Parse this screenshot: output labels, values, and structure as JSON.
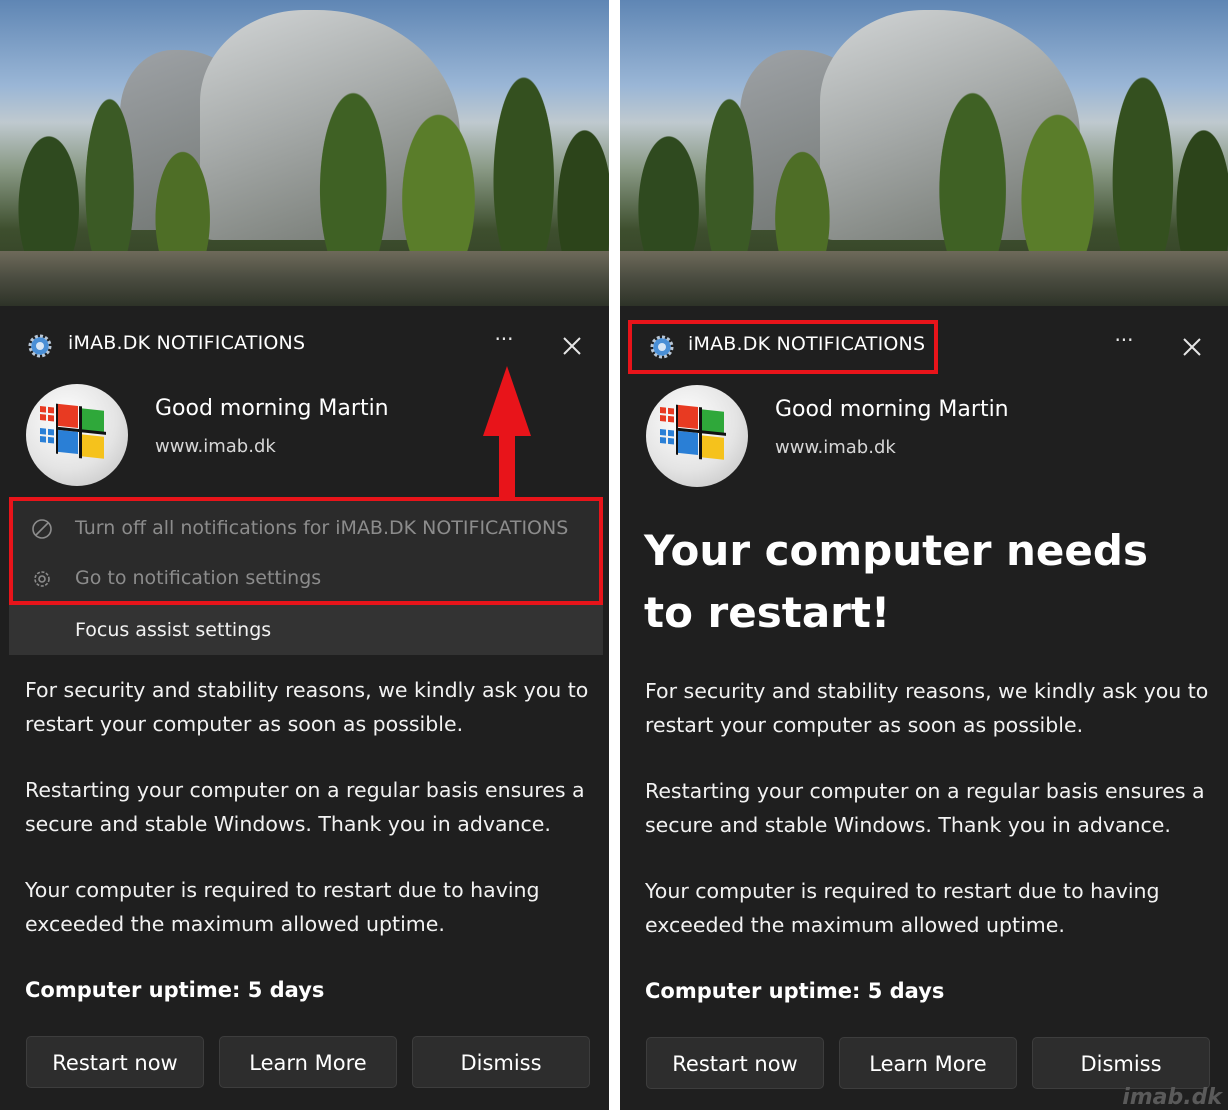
{
  "notification": {
    "app_name": "iMAB.DK NOTIFICATIONS",
    "more_label": "···",
    "sender_name": "Good morning Martin",
    "sender_url": "www.imab.dk",
    "title": "Your computer needs to restart!",
    "paragraphs": [
      "For security and stability reasons, we kindly ask you to restart your computer as soon as possible.",
      "Restarting your computer on a regular basis ensures a secure and stable Windows. Thank you in advance.",
      "Your computer is required to restart due to having exceeded the maximum allowed uptime."
    ],
    "uptime_label": "Computer uptime:",
    "uptime_value": "5 days",
    "buttons": {
      "restart": "Restart now",
      "learn_more": "Learn More",
      "dismiss": "Dismiss"
    }
  },
  "context_menu": {
    "items": [
      {
        "label": "Turn off all notifications for iMAB.DK NOTIFICATIONS",
        "icon": "block-icon"
      },
      {
        "label": "Go to notification settings",
        "icon": "gear-icon"
      },
      {
        "label": "Focus assist settings",
        "icon": ""
      }
    ]
  },
  "watermark": "imab.dk",
  "colors": {
    "background": "#1f1f1f",
    "menu": "#2b2b2b",
    "highlight": "#e8141a",
    "button": "#2d2d2d",
    "text": "#ffffff"
  }
}
